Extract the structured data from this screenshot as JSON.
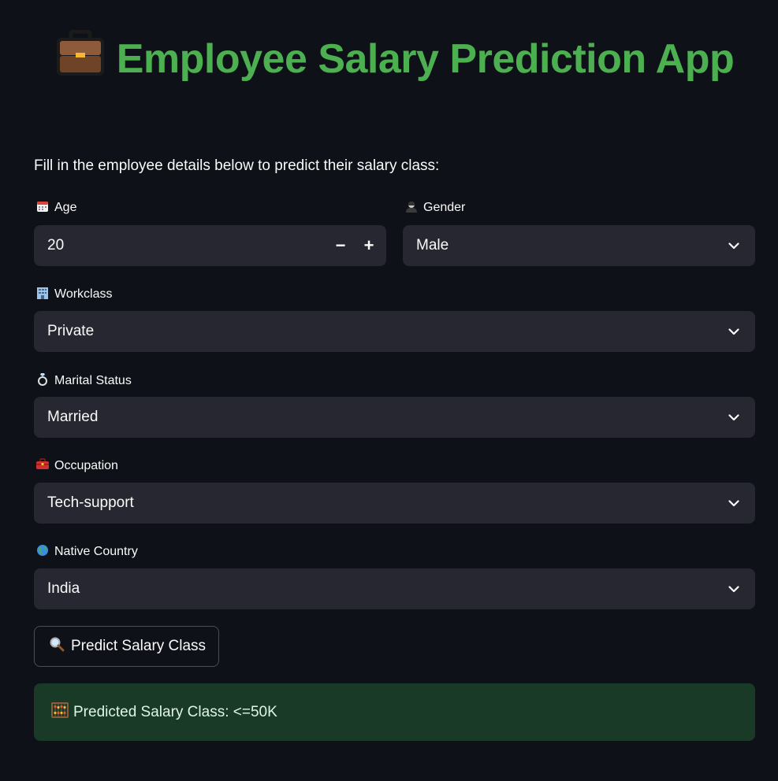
{
  "header": {
    "icon": "briefcase-icon",
    "title": "Employee Salary Prediction App"
  },
  "intro": "Fill in the employee details below to predict their salary class:",
  "fields": {
    "age": {
      "icon": "calendar-icon",
      "label": "Age",
      "value": "20",
      "minus": "−",
      "plus": "+"
    },
    "gender": {
      "icon": "person-icon",
      "label": "Gender",
      "value": "Male"
    },
    "workclass": {
      "icon": "office-building-icon",
      "label": "Workclass",
      "value": "Private"
    },
    "marital": {
      "icon": "ring-icon",
      "label": "Marital Status",
      "value": "Married"
    },
    "occupation": {
      "icon": "toolbox-icon",
      "label": "Occupation",
      "value": "Tech-support"
    },
    "country": {
      "icon": "globe-icon",
      "label": "Native Country",
      "value": "India"
    }
  },
  "predict_button": {
    "icon": "search-icon",
    "label": "Predict Salary Class"
  },
  "result": {
    "icon": "abacus-icon",
    "text": "Predicted Salary Class: <=50K"
  },
  "colors": {
    "background": "#0e1117",
    "accent_green": "#4caf50",
    "input_bg": "#262730",
    "success_bg": "#1a3a28"
  }
}
